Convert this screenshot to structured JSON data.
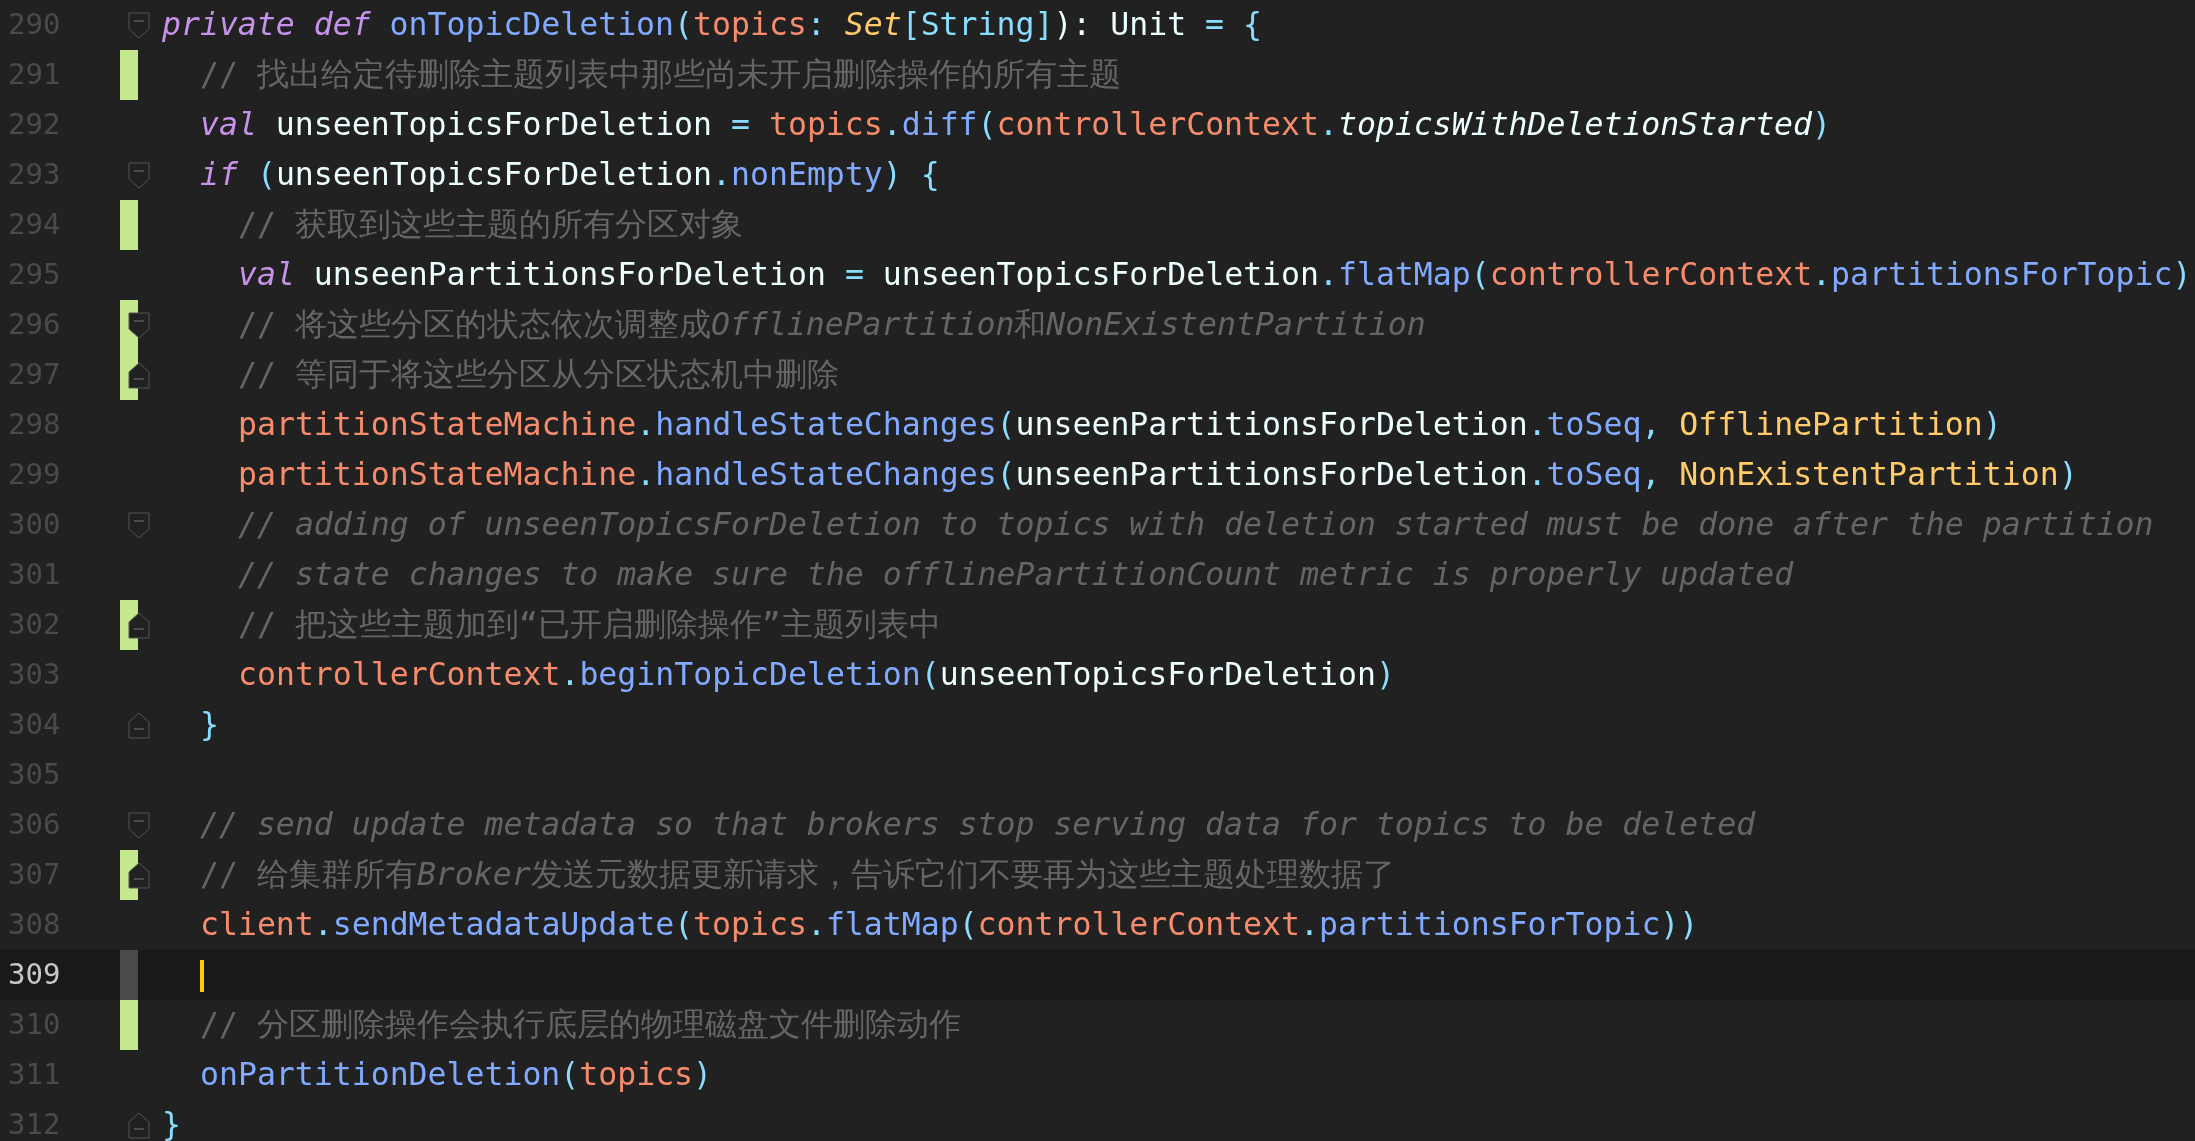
{
  "lines": [
    {
      "number": "290",
      "fold_start": true,
      "code": [
        {
          "text": "private def ",
          "kind": "keyword"
        },
        {
          "text": "onTopicDeletion",
          "kind": "fn"
        },
        {
          "text": "(",
          "kind": "op"
        },
        {
          "text": "topics",
          "kind": "obj"
        },
        {
          "text": ": ",
          "kind": "op"
        },
        {
          "text": "Set",
          "kind": "type-it"
        },
        {
          "text": "[String]",
          "kind": "op"
        },
        {
          "text": "): Unit ",
          "kind": "plain"
        },
        {
          "text": "= {",
          "kind": "op"
        }
      ],
      "children": [
        {
          "number": "291",
          "changed": true,
          "code": [
            {
              "text": "// 找出给定待删除主题列表中那些尚未开启删除操作的所有主题",
              "kind": "comment"
            }
          ]
        },
        {
          "number": "292",
          "code": [
            {
              "text": "val ",
              "kind": "keyword"
            },
            {
              "text": "unseenTopicsForDeletion ",
              "kind": "plain"
            },
            {
              "text": "= ",
              "kind": "op"
            },
            {
              "text": "topics",
              "kind": "obj"
            },
            {
              "text": ".",
              "kind": "op"
            },
            {
              "text": "diff",
              "kind": "fn"
            },
            {
              "text": "(",
              "kind": "op"
            },
            {
              "text": "controllerContext",
              "kind": "obj"
            },
            {
              "text": ".",
              "kind": "op"
            },
            {
              "text": "topicsWithDeletionStarted",
              "kind": "plain-it"
            },
            {
              "text": ")",
              "kind": "op"
            }
          ]
        },
        {
          "number": "293",
          "fold_start": true,
          "code": [
            {
              "text": "if ",
              "kind": "keyword"
            },
            {
              "text": "(",
              "kind": "op"
            },
            {
              "text": "unseenTopicsForDeletion",
              "kind": "plain"
            },
            {
              "text": ".",
              "kind": "op"
            },
            {
              "text": "nonEmpty",
              "kind": "fn"
            },
            {
              "text": ") {",
              "kind": "op"
            }
          ],
          "children": [
            {
              "number": "294",
              "changed": true,
              "code": [
                {
                  "text": "// 获取到这些主题的所有分区对象",
                  "kind": "comment"
                }
              ]
            },
            {
              "number": "295",
              "code": [
                {
                  "text": "val ",
                  "kind": "keyword"
                },
                {
                  "text": "unseenPartitionsForDeletion ",
                  "kind": "plain"
                },
                {
                  "text": "= ",
                  "kind": "op"
                },
                {
                  "text": "unseenTopicsForDeletion",
                  "kind": "plain"
                },
                {
                  "text": ".",
                  "kind": "op"
                },
                {
                  "text": "flatMap",
                  "kind": "fn"
                },
                {
                  "text": "(",
                  "kind": "op"
                },
                {
                  "text": "controllerContext",
                  "kind": "obj"
                },
                {
                  "text": ".",
                  "kind": "op"
                },
                {
                  "text": "partitionsForTopic",
                  "kind": "fn"
                },
                {
                  "text": ")",
                  "kind": "op"
                }
              ]
            },
            {
              "number": "296",
              "changed": true,
              "fold_start": true,
              "code": [
                {
                  "text": "// 将这些分区的状态依次调整成",
                  "kind": "comment"
                },
                {
                  "text": "OfflinePartition",
                  "kind": "comment-it"
                },
                {
                  "text": "和",
                  "kind": "comment"
                },
                {
                  "text": "NonExistentPartition",
                  "kind": "comment-it"
                }
              ]
            },
            {
              "number": "297",
              "changed": true,
              "fold_end": true,
              "code": [
                {
                  "text": "// 等同于将这些分区从分区状态机中删除",
                  "kind": "comment"
                }
              ]
            },
            {
              "number": "298",
              "code": [
                {
                  "text": "partitionStateMachine",
                  "kind": "obj"
                },
                {
                  "text": ".",
                  "kind": "op"
                },
                {
                  "text": "handleStateChanges",
                  "kind": "fn"
                },
                {
                  "text": "(",
                  "kind": "op"
                },
                {
                  "text": "unseenPartitionsForDeletion",
                  "kind": "plain"
                },
                {
                  "text": ".",
                  "kind": "op"
                },
                {
                  "text": "toSeq",
                  "kind": "fn"
                },
                {
                  "text": ", ",
                  "kind": "op"
                },
                {
                  "text": "OfflinePartition",
                  "kind": "type"
                },
                {
                  "text": ")",
                  "kind": "op"
                }
              ]
            },
            {
              "number": "299",
              "code": [
                {
                  "text": "partitionStateMachine",
                  "kind": "obj"
                },
                {
                  "text": ".",
                  "kind": "op"
                },
                {
                  "text": "handleStateChanges",
                  "kind": "fn"
                },
                {
                  "text": "(",
                  "kind": "op"
                },
                {
                  "text": "unseenPartitionsForDeletion",
                  "kind": "plain"
                },
                {
                  "text": ".",
                  "kind": "op"
                },
                {
                  "text": "toSeq",
                  "kind": "fn"
                },
                {
                  "text": ", ",
                  "kind": "op"
                },
                {
                  "text": "NonExistentPartition",
                  "kind": "type"
                },
                {
                  "text": ")",
                  "kind": "op"
                }
              ]
            },
            {
              "number": "300",
              "fold_start": true,
              "code": [
                {
                  "text": "// adding of unseenTopicsForDeletion to topics with deletion started must be done after the partition",
                  "kind": "comment-it"
                }
              ]
            },
            {
              "number": "301",
              "code": [
                {
                  "text": "// state changes to make sure the offlinePartitionCount metric is properly updated",
                  "kind": "comment-it"
                }
              ]
            },
            {
              "number": "302",
              "changed": true,
              "fold_end": true,
              "code": [
                {
                  "text": "// 把这些主题加到“已开启删除操作”主题列表中",
                  "kind": "comment"
                }
              ]
            },
            {
              "number": "303",
              "code": [
                {
                  "text": "controllerContext",
                  "kind": "obj"
                },
                {
                  "text": ".",
                  "kind": "op"
                },
                {
                  "text": "beginTopicDeletion",
                  "kind": "fn"
                },
                {
                  "text": "(",
                  "kind": "op"
                },
                {
                  "text": "unseenTopicsForDeletion",
                  "kind": "plain"
                },
                {
                  "text": ")",
                  "kind": "op"
                }
              ]
            }
          ]
        },
        {
          "number": "304",
          "fold_end": true,
          "code": [
            {
              "text": "}",
              "kind": "op"
            }
          ]
        },
        {
          "number": "305"
        },
        {
          "number": "306",
          "fold_start": true,
          "code": [
            {
              "text": "// send update metadata so that brokers stop serving data for topics to be deleted",
              "kind": "comment-it"
            }
          ]
        },
        {
          "number": "307",
          "changed": true,
          "fold_end": true,
          "code": [
            {
              "text": "// 给集群所有",
              "kind": "comment"
            },
            {
              "text": "Broker",
              "kind": "comment-it"
            },
            {
              "text": "发送元数据更新请求，告诉它们不要再为这些主题处理数据了",
              "kind": "comment"
            }
          ]
        },
        {
          "number": "308",
          "code": [
            {
              "text": "client",
              "kind": "obj"
            },
            {
              "text": ".",
              "kind": "op"
            },
            {
              "text": "sendMetadataUpdate",
              "kind": "fn"
            },
            {
              "text": "(",
              "kind": "op"
            },
            {
              "text": "topics",
              "kind": "obj"
            },
            {
              "text": ".",
              "kind": "op"
            },
            {
              "text": "flatMap",
              "kind": "fn"
            },
            {
              "text": "(",
              "kind": "op"
            },
            {
              "text": "controllerContext",
              "kind": "obj"
            },
            {
              "text": ".",
              "kind": "op"
            },
            {
              "text": "partitionsForTopic",
              "kind": "fn"
            },
            {
              "text": "))",
              "kind": "op"
            }
          ]
        },
        {
          "number": "309",
          "current": true
        },
        {
          "number": "310",
          "changed": true,
          "code": [
            {
              "text": "// 分区删除操作会执行底层的物理磁盘文件删除动作",
              "kind": "comment"
            }
          ]
        },
        {
          "number": "311",
          "code": [
            {
              "text": "onPartitionDeletion",
              "kind": "fn"
            },
            {
              "text": "(",
              "kind": "op"
            },
            {
              "text": "topics",
              "kind": "obj"
            },
            {
              "text": ")",
              "kind": "op"
            }
          ]
        }
      ]
    },
    {
      "number": "312",
      "fold_end": true,
      "code": [
        {
          "text": "}",
          "kind": "op"
        }
      ]
    }
  ]
}
